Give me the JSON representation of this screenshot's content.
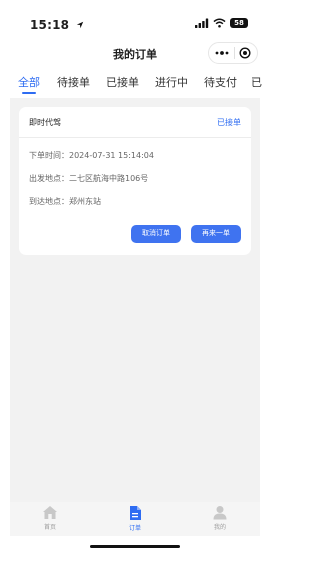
{
  "status_bar": {
    "time": "15:18",
    "battery": "58"
  },
  "nav": {
    "title": "我的订单"
  },
  "tabs": [
    {
      "label": "全部",
      "active": true
    },
    {
      "label": "待接单",
      "active": false
    },
    {
      "label": "已接单",
      "active": false
    },
    {
      "label": "进行中",
      "active": false
    },
    {
      "label": "待支付",
      "active": false
    },
    {
      "label": "已",
      "active": false
    }
  ],
  "order": {
    "type": "即时代驾",
    "status": "已接单",
    "order_time_label": "下单时间：",
    "order_time": "2024-07-31 15:14:04",
    "from_label": "出发地点：",
    "from": "二七区航海中路106号",
    "to_label": "到达地点：",
    "to": "郑州东站",
    "cancel_label": "取消订单",
    "reorder_label": "再来一单"
  },
  "tabbar": [
    {
      "label": "首页",
      "icon": "home-icon",
      "active": false
    },
    {
      "label": "订单",
      "icon": "order-icon",
      "active": true
    },
    {
      "label": "我的",
      "icon": "profile-icon",
      "active": false
    }
  ],
  "colors": {
    "accent": "#2e6cf2",
    "button": "#3f73f0",
    "background": "#f2f2f2"
  }
}
